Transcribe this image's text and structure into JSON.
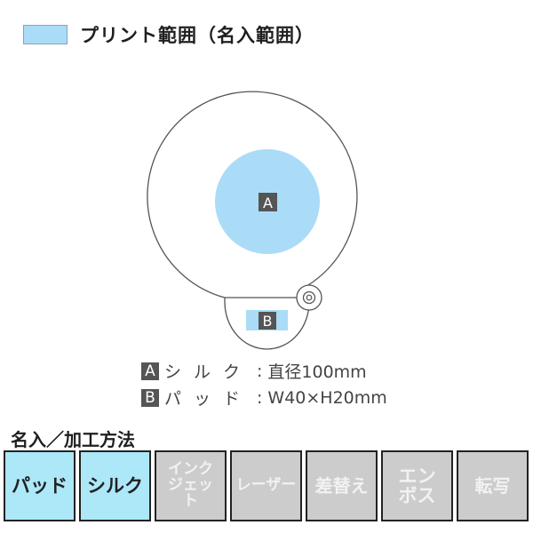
{
  "legend": {
    "label": "プリント範囲（名入範囲）",
    "swatch_color": "#aadcf7"
  },
  "diagram": {
    "area_a_label": "A",
    "area_b_label": "B",
    "print_color": "#aadcf7",
    "outline_color": "#555555",
    "tag_color": "#555555"
  },
  "specs": [
    {
      "tag": "A",
      "method": "シルク",
      "separator": ":",
      "size": "直径100mm"
    },
    {
      "tag": "B",
      "method": "パッド",
      "separator": ":",
      "size": "W40×H20mm"
    }
  ],
  "methods_section": {
    "title": "名入／加工方法",
    "items": [
      {
        "label": "パッド",
        "available": true
      },
      {
        "label": "シルク",
        "available": true
      },
      {
        "label": "インクジェット",
        "available": false
      },
      {
        "label": "レーザー",
        "available": false
      },
      {
        "label": "差替え",
        "available": false
      },
      {
        "label": "エンボス",
        "available": false
      },
      {
        "label": "転写",
        "available": false
      }
    ],
    "active_color": "#ade8f9",
    "inactive_color": "#cccccc"
  }
}
